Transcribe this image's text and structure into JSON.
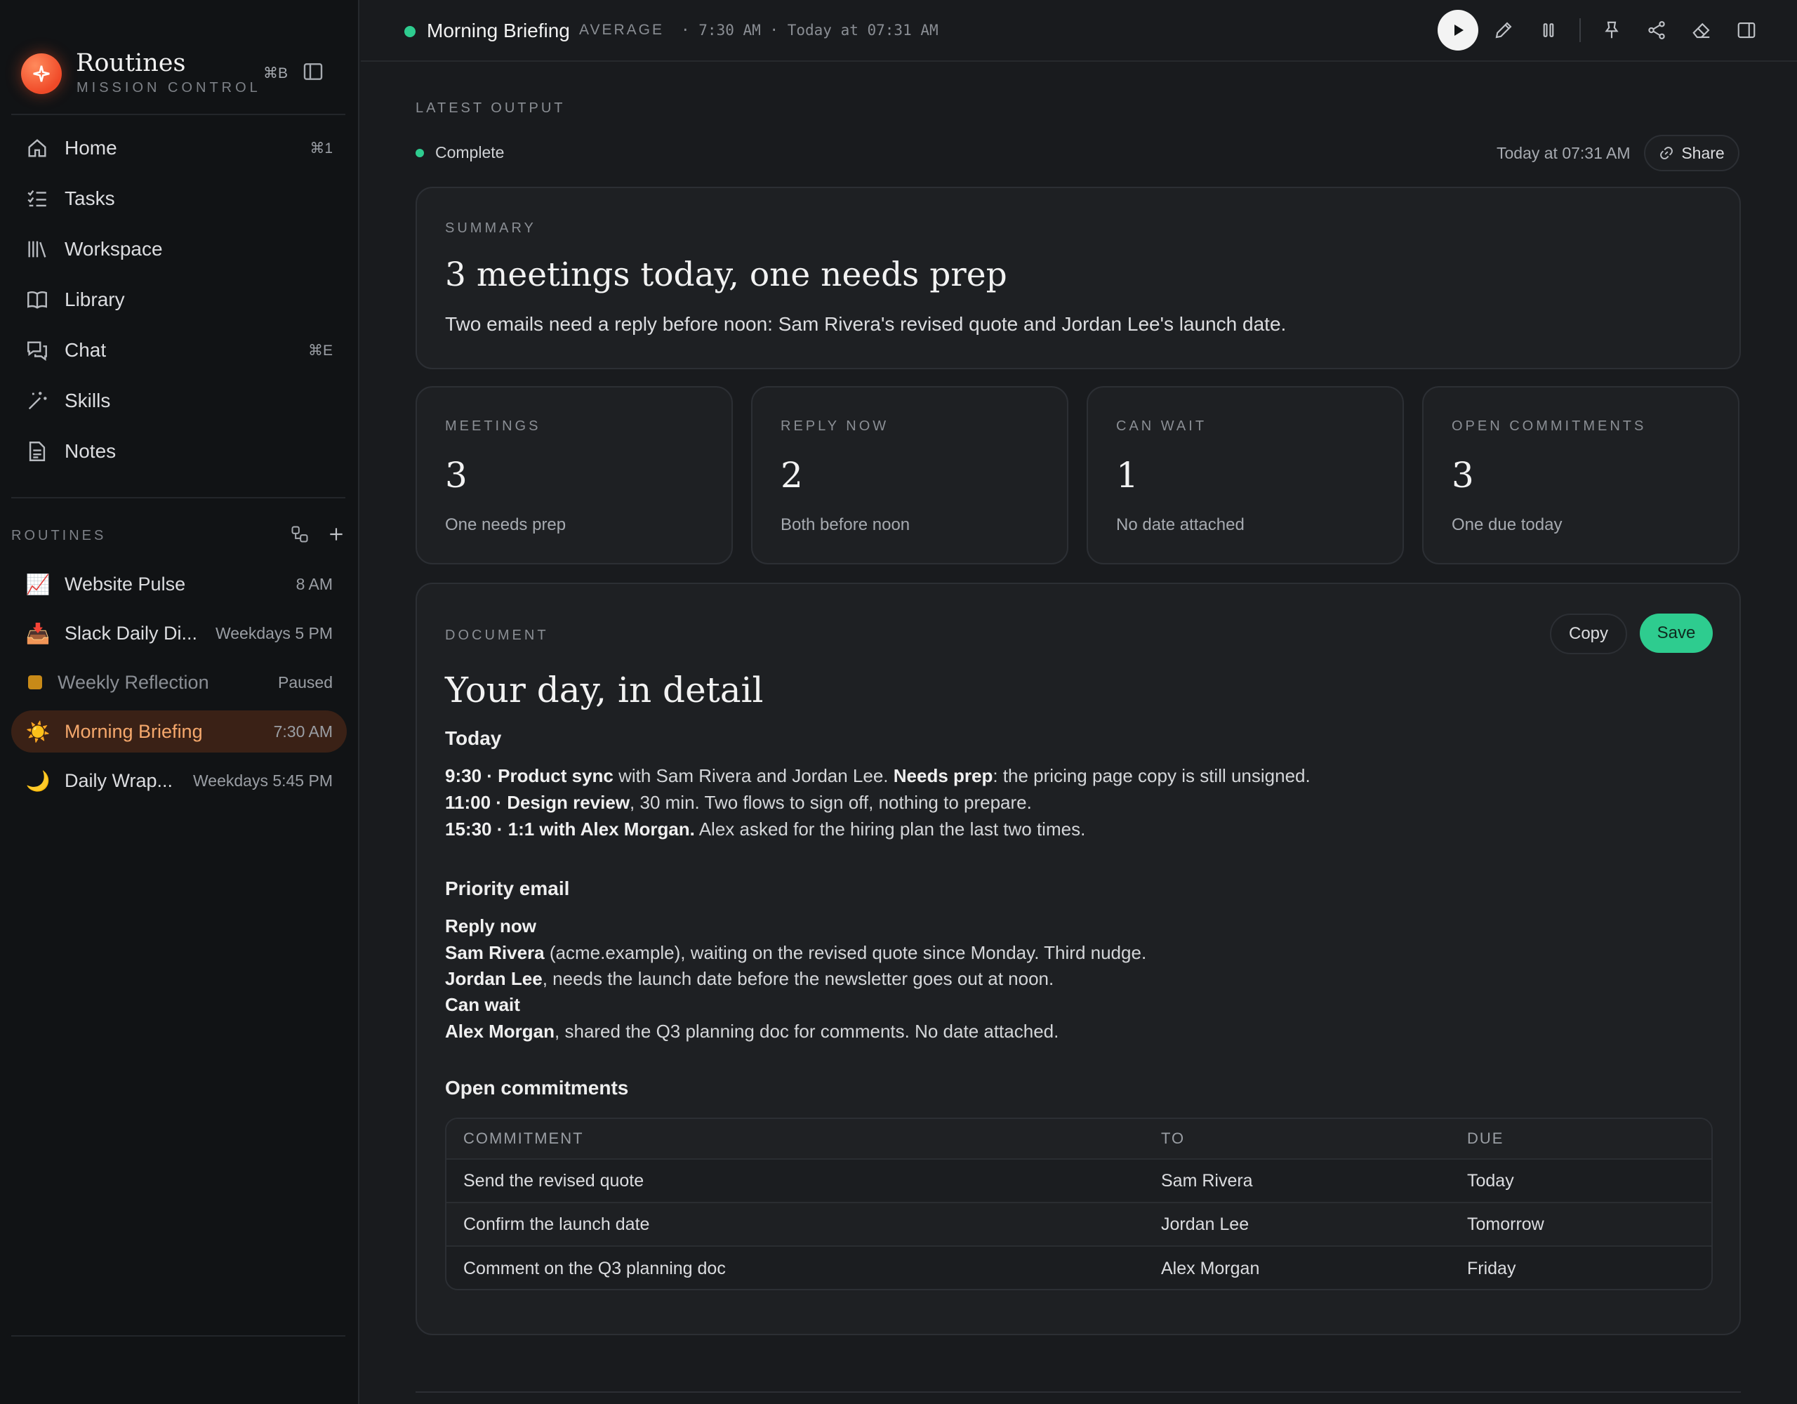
{
  "app": {
    "title": "Routines",
    "subtitle": "MISSION CONTROL",
    "toggle_shortcut": "⌘B"
  },
  "nav": [
    {
      "label": "Home",
      "shortcut": "⌘1",
      "icon": "home-icon"
    },
    {
      "label": "Tasks",
      "shortcut": "",
      "icon": "tasks-icon"
    },
    {
      "label": "Workspace",
      "shortcut": "",
      "icon": "workspace-icon"
    },
    {
      "label": "Library",
      "shortcut": "",
      "icon": "book-icon"
    },
    {
      "label": "Chat",
      "shortcut": "⌘E",
      "icon": "chat-icon"
    },
    {
      "label": "Skills",
      "shortcut": "",
      "icon": "magic-wand-icon"
    },
    {
      "label": "Notes",
      "shortcut": "",
      "icon": "note-icon"
    }
  ],
  "routines": {
    "heading": "ROUTINES",
    "items": [
      {
        "emoji": "📈",
        "name": "Website Pulse",
        "time": "8 AM"
      },
      {
        "emoji": "📥",
        "name": "Slack Daily Di...",
        "time": "Weekdays 5 PM"
      },
      {
        "emoji": "",
        "name": "Weekly Reflection",
        "time": "Paused"
      },
      {
        "emoji": "☀️",
        "name": "Morning Briefing",
        "time": "7:30 AM"
      },
      {
        "emoji": "🌙",
        "name": "Daily Wrap...",
        "time": "Weekdays 5:45 PM"
      }
    ]
  },
  "header": {
    "title": "Morning Briefing",
    "mode": "AVERAGE",
    "meta": "· 7:30 AM · Today at 07:31 AM"
  },
  "output": {
    "label": "LATEST OUTPUT",
    "status": "Complete",
    "time": "Today at 07:31 AM",
    "share_label": "Share"
  },
  "summary": {
    "label": "SUMMARY",
    "headline": "3 meetings today, one needs prep",
    "body": "Two emails need a reply before noon: Sam Rivera's revised quote and Jordan Lee's launch date."
  },
  "stats": [
    {
      "label": "MEETINGS",
      "value": "3",
      "sub": "One needs prep"
    },
    {
      "label": "REPLY NOW",
      "value": "2",
      "sub": "Both before noon"
    },
    {
      "label": "CAN WAIT",
      "value": "1",
      "sub": "No date attached"
    },
    {
      "label": "OPEN COMMITMENTS",
      "value": "3",
      "sub": "One due today"
    }
  ],
  "document": {
    "label": "DOCUMENT",
    "copy_label": "Copy",
    "save_label": "Save",
    "title": "Your day, in detail",
    "today_heading": "Today",
    "meetings": [
      {
        "time": "9:30",
        "name": "Product sync",
        "rest1": " with Sam Rivera and Jordan Lee. ",
        "flag": "Needs prep",
        "rest2": ": the pricing page copy is still unsigned."
      },
      {
        "time": "11:00",
        "name": "Design review",
        "rest1": ", 30 min. Two flows to sign off, nothing to prepare.",
        "flag": "",
        "rest2": ""
      },
      {
        "time": "15:30",
        "name": "1:1 with Alex Morgan.",
        "rest1": " Alex asked for the hiring plan the last two times.",
        "flag": "",
        "rest2": ""
      }
    ],
    "email_heading": "Priority email",
    "reply_now_label": "Reply now",
    "reply_now": [
      {
        "who": "Sam Rivera",
        "text": " (acme.example), waiting on the revised quote since Monday. Third nudge."
      },
      {
        "who": "Jordan Lee",
        "text": ", needs the launch date before the newsletter goes out at noon."
      }
    ],
    "can_wait_label": "Can wait",
    "can_wait": [
      {
        "who": "Alex Morgan",
        "text": ", shared the Q3 planning doc for comments. No date attached."
      }
    ],
    "commitments_heading": "Open commitments",
    "table": {
      "headers": [
        "COMMITMENT",
        "TO",
        "DUE"
      ],
      "rows": [
        [
          "Send the revised quote",
          "Sam Rivera",
          "Today"
        ],
        [
          "Confirm the launch date",
          "Jordan Lee",
          "Tomorrow"
        ],
        [
          "Comment on the Q3 planning doc",
          "Alex Morgan",
          "Friday"
        ]
      ]
    }
  },
  "colors": {
    "accent_green": "#2ecc8f",
    "active_routine_bg": "#3a2116",
    "active_routine_text": "#f5a86c",
    "paused": "#c88a18",
    "brand": "#f04a28"
  }
}
